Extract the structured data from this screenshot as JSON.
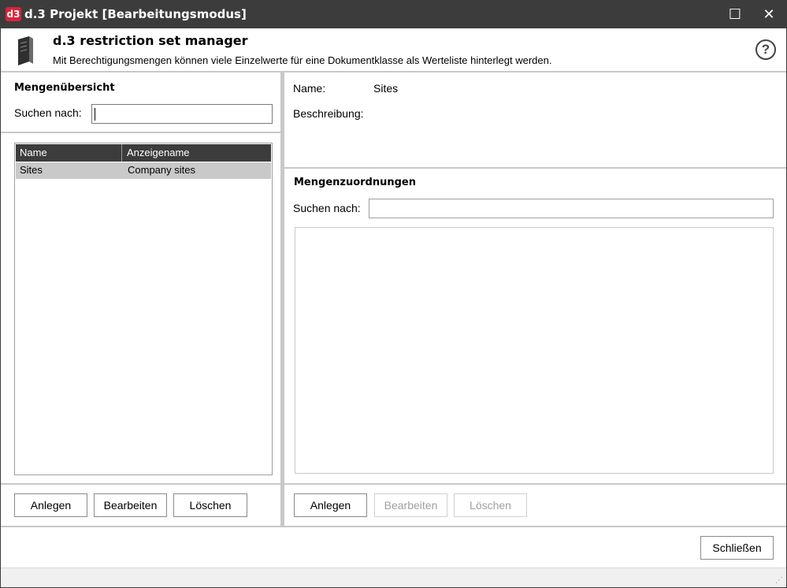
{
  "window": {
    "logo": "d3",
    "title": "d.3 Projekt [Bearbeitungsmodus]",
    "maximize_glyph": "☐",
    "close_glyph": "✕"
  },
  "header": {
    "title": "d.3 restriction set manager",
    "description": "Mit Berechtigungsmengen können viele Einzelwerte für eine Dokumentklasse als Werteliste hinterlegt werden.",
    "help_glyph": "?"
  },
  "left_panel": {
    "section_title": "Mengenübersicht",
    "search_label": "Suchen nach:",
    "search_value": "",
    "columns": [
      "Name",
      "Anzeigename"
    ],
    "rows": [
      {
        "name": "Sites",
        "display_name": "Company sites",
        "selected": true
      }
    ],
    "buttons": {
      "create": "Anlegen",
      "edit": "Bearbeiten",
      "delete": "Löschen"
    }
  },
  "right_panel": {
    "name_label": "Name:",
    "name_value": "Sites",
    "description_label": "Beschreibung:",
    "description_value": "",
    "assignments_title": "Mengenzuordnungen",
    "search_label": "Suchen nach:",
    "search_value": "",
    "buttons": {
      "create": "Anlegen",
      "edit": "Bearbeiten",
      "delete": "Löschen"
    },
    "buttons_disabled": {
      "create": false,
      "edit": true,
      "delete": true
    }
  },
  "footer": {
    "close_button": "Schließen"
  },
  "icons": [
    "app-logo-icon",
    "book-icon",
    "help-icon",
    "maximize-icon",
    "close-icon",
    "resize-grip-icon"
  ],
  "colors": {
    "titlebar": "#3c3c3c",
    "logo": "#d9243b",
    "selected_row": "#c9c9c9"
  }
}
